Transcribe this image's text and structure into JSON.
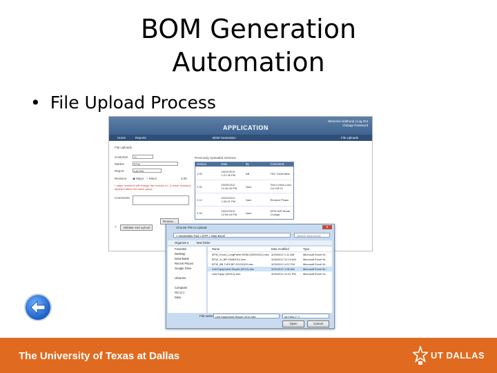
{
  "slide": {
    "title_line1": "BOM Generation",
    "title_line2": "Automation",
    "bullet": "File Upload Process"
  },
  "app": {
    "welcome": "Welcome siddhuop | Log Out",
    "change_password": "Change Password",
    "title": "APPLICATION",
    "nav": [
      "Home",
      "Reports",
      "BOM Generation",
      "File Uploads"
    ],
    "section_title": "File Uploads",
    "fields": {
      "customer_label": "Customer",
      "customer_value": "TI",
      "market_label": "Market",
      "market_value": "ETW",
      "report_label": "Report",
      "report_value": "Lab Std",
      "revision_label": "Revision",
      "revision_major": "Major",
      "revision_minor": "Minor",
      "revision_value": "3.00",
      "note": "* major revisions will change the revision no. & minor revisions appears within the same group",
      "comments_label": "Comments"
    },
    "browse_button": "Browse...",
    "validate_button": "Validate and upload",
    "previous_title": "Previously Uploaded Versions",
    "previous_headers": [
      "Version",
      "Date",
      "By",
      "Comments"
    ],
    "previous_rows": [
      {
        "version": "1.00",
        "date": "03/29/2012 1:07:38 PM",
        "by": "AB",
        "comments": "TBC Generation"
      },
      {
        "version": "2.00",
        "date": "03/28/2012 12:46:40 PM",
        "by": "Nam",
        "comments": "Test a Heat Load Cal GB 01"
      },
      {
        "version": "2.12",
        "date": "03/29/2012 1:00:31 PM",
        "by": "Nam",
        "comments": "Revised Phase"
      },
      {
        "version": "2.33",
        "date": "03/29/2012 12:06:18 PM",
        "by": "Nam",
        "comments": "DPW AIR Break Change"
      }
    ]
  },
  "dialog": {
    "title": "Choose File to Upload",
    "close": "x",
    "address": "« Automation Tool » DTP » Step Excel",
    "search_placeholder": "Search Step Excel",
    "toolbar": [
      "Organize ▾",
      "New folder"
    ],
    "nav_items": [
      "Favorites",
      "Desktop",
      "Downloads",
      "Recent Places",
      "Google Drive",
      "",
      "Libraries",
      "",
      "Computer",
      "OS (C:)",
      "Data"
    ],
    "file_headers": [
      "Name",
      "Date modified",
      "Type"
    ],
    "files": [
      {
        "name": "BTW_Excel_LongPrefer BOM (03292012).xlsx",
        "date": "3/29/2012 1:11 AM",
        "type": "Microsoft Excel W...",
        "selected": false
      },
      {
        "name": "BTW_Xl_BP 03282012.xlsx",
        "date": "3/28/2012 12:13 AM",
        "type": "Microsoft Excel W...",
        "selected": false
      },
      {
        "name": "BTW_BB TxPit BP 20120329.xlsx",
        "date": "3/29/2012 4:22 PM",
        "type": "Microsoft Excel W...",
        "selected": false
      },
      {
        "name": "Unit Equipment Report (3212).xlsx",
        "date": "3/22/2012 1:06 AM",
        "type": "Microsoft Excel W...",
        "selected": true
      },
      {
        "name": "Unit Equip (32912).xlsx",
        "date": "3/29/2012 11:22 PM",
        "type": "Microsoft Excel W...",
        "selected": false
      }
    ],
    "filename_label": "File name:",
    "filename_value": "Unit Equipment Report 3212.xlsx",
    "filetype_value": "All Files (*.*)",
    "open_button": "Open",
    "cancel_button": "Cancel"
  },
  "footer": {
    "university": "The University of Texas at Dallas",
    "logo_text": "DALLAS",
    "logo_initials": "UT"
  },
  "colors": {
    "footer_orange": "#e06a20",
    "app_header_blue": "#3f6490",
    "back_button_blue": "#1a5fc8"
  },
  "icons": {
    "back": "left-arrow-icon",
    "star": "star-icon"
  }
}
